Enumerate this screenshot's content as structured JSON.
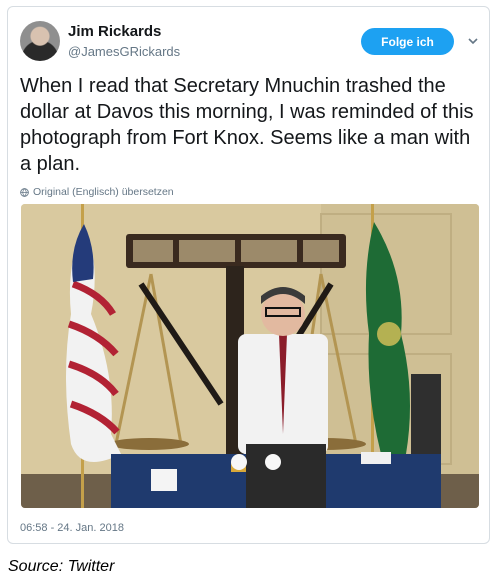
{
  "tweet": {
    "author_name": "Jim Rickards",
    "author_handle": "@JamesGRickards",
    "follow_label": "Folge ich",
    "text": "When I read that Secretary Mnuchin trashed the dollar at Davos this morning, I was reminded of this photograph from Fort Knox. Seems like a man with a plan.",
    "translate_label": "Original (Englisch) übersetzen",
    "timestamp": "06:58 - 24. Jan. 2018"
  },
  "caption": "Source: Twitter",
  "icons": [
    "avatar",
    "chevron-down-icon",
    "globe-icon"
  ],
  "colors": {
    "accent": "#1da1f2",
    "secondary_text": "#657786"
  }
}
